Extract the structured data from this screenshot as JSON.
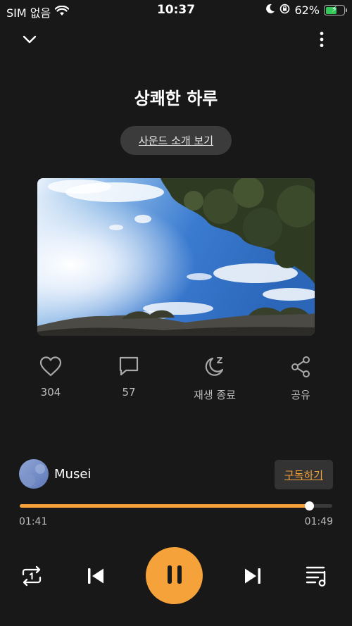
{
  "status_bar": {
    "carrier": "SIM 없음",
    "time": "10:37",
    "battery_percent": "62%",
    "battery_level": 0.62,
    "icons": [
      "wifi-icon",
      "moon-icon",
      "orientation-lock-icon",
      "battery-charging-icon"
    ]
  },
  "header": {
    "collapse_icon": "chevron-down-icon",
    "more_icon": "more-vertical-icon"
  },
  "title": "상쾌한 하루",
  "intro_button": "사운드 소개 보기",
  "artwork": {
    "description_icon": "sky-trees-artwork"
  },
  "actions": {
    "like": {
      "label": "304",
      "icon": "heart-icon"
    },
    "comment": {
      "label": "57",
      "icon": "comment-icon"
    },
    "sleep_timer": {
      "label": "재생 종료",
      "icon": "moon-zzz-icon"
    },
    "share": {
      "label": "공유",
      "icon": "share-icon"
    }
  },
  "channel": {
    "name": "Musei",
    "subscribe_label": "구독하기"
  },
  "playback": {
    "elapsed": "01:41",
    "duration": "01:49",
    "progress": 0.925
  },
  "controls": {
    "repeat_icon": "repeat-one-icon",
    "prev_icon": "skip-previous-icon",
    "play_pause_icon": "pause-icon",
    "next_icon": "skip-next-icon",
    "playlist_icon": "playlist-music-icon"
  },
  "colors": {
    "background": "#181818",
    "accent": "#f5a23a",
    "pill": "#3b3b3b",
    "muted_text": "#bdbdbd"
  }
}
